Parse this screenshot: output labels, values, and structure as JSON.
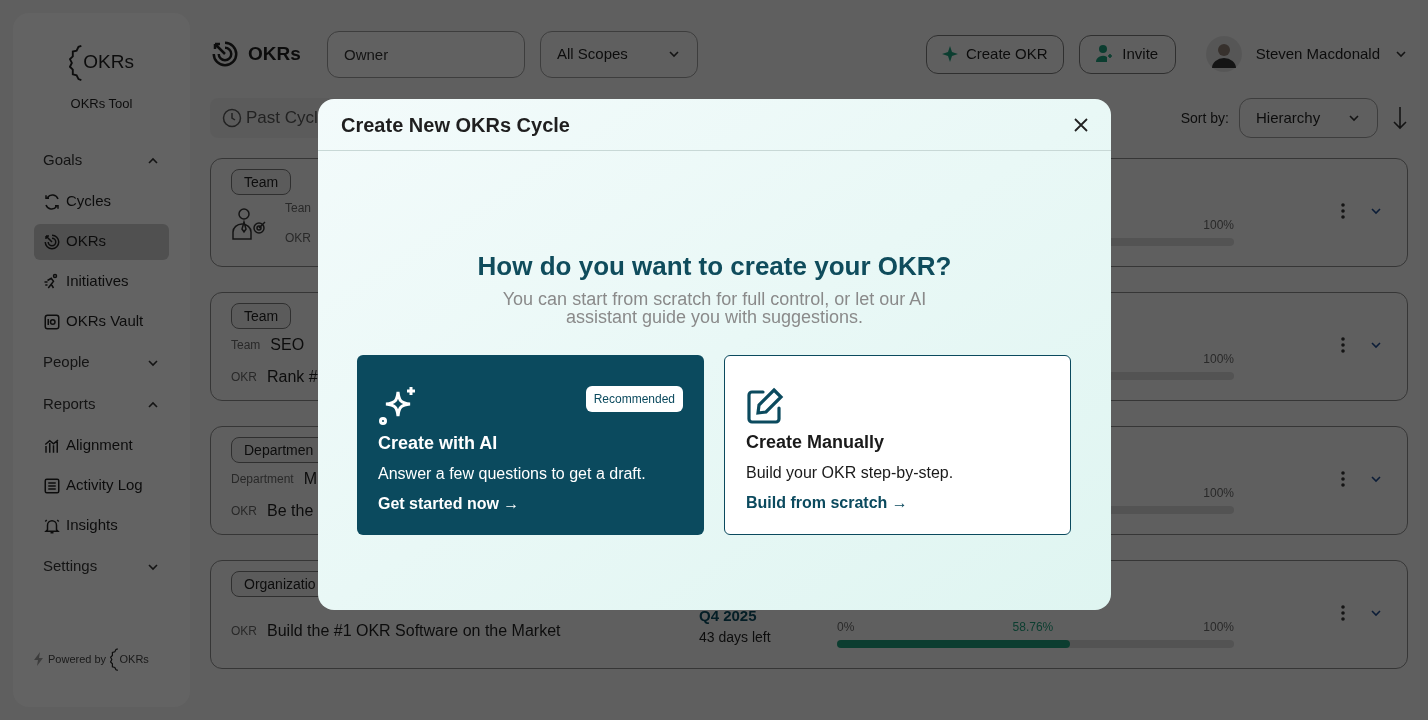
{
  "header": {
    "logo_text": "OKRs",
    "owner_placeholder": "Owner",
    "scope": "All Scopes",
    "create_button": "Create OKR",
    "invite_button": "Invite",
    "user_name": "Steven Macdonald"
  },
  "sidebar": {
    "logo_text": "OKRs",
    "app_name": "OKRs Tool",
    "items": [
      {
        "kind": "section",
        "label": "Goals",
        "expanded": true
      },
      {
        "kind": "link",
        "label": "Cycles",
        "selected": false
      },
      {
        "kind": "link",
        "label": "OKRs",
        "selected": true
      },
      {
        "kind": "link",
        "label": "Initiatives",
        "selected": false
      },
      {
        "kind": "link",
        "label": "OKRs Vault",
        "selected": false
      },
      {
        "kind": "section",
        "label": "People",
        "expanded": false
      },
      {
        "kind": "section",
        "label": "Reports",
        "expanded": true
      },
      {
        "kind": "link",
        "label": "Alignment",
        "selected": false
      },
      {
        "kind": "link",
        "label": "Activity Log",
        "selected": false
      },
      {
        "kind": "link",
        "label": "Insights",
        "selected": false
      },
      {
        "kind": "section",
        "label": "Settings",
        "expanded": false
      }
    ],
    "footer": {
      "label": "Powered by",
      "logo_text": "OKRs"
    }
  },
  "toolbar": {
    "past_cycles": "Past Cycl",
    "sort_label": "Sort by:",
    "sort_value": "Hierarchy"
  },
  "cards": [
    {
      "kind": "icon",
      "tag": "Team",
      "rows": [
        {
          "label": "Tean"
        },
        {
          "label": "OKR"
        }
      ],
      "progress": {
        "max": "100%"
      }
    },
    {
      "kind": "rows",
      "tag": "Team",
      "rows": [
        {
          "label": "Team",
          "value": "SEO"
        },
        {
          "label": "OKR",
          "value": "Rank #"
        }
      ],
      "progress": {
        "max": "100%"
      }
    },
    {
      "kind": "rows",
      "tag": "Departmen",
      "rows": [
        {
          "label": "Department",
          "value": "M"
        },
        {
          "label": "OKR",
          "value": "Be the"
        }
      ],
      "progress": {
        "max": "100%"
      }
    },
    {
      "kind": "rows",
      "tag": "Organizatio",
      "rows": [
        {
          "label": "OKR",
          "value": "Build the #1 OKR Software on the Market"
        }
      ],
      "cycle": "Q4 2025",
      "days_left": "43 days left",
      "progress": {
        "min": "0%",
        "value_label": "58.76%",
        "max": "100%",
        "level": 0.5876
      }
    }
  ],
  "modal": {
    "title": "Create New OKRs Cycle",
    "heading": "How do you want to create your OKR?",
    "subtitle": "You can start from scratch for full control, or let our AI assistant guide you with suggestions.",
    "options": [
      {
        "kind": "ai",
        "title": "Create with AI",
        "badge": "Recommended",
        "description": "Answer a few questions to get a draft.",
        "link": "Get started now →"
      },
      {
        "kind": "manual",
        "title": "Create Manually",
        "description": "Build your OKR step-by-step.",
        "link": "Build from scratch →"
      }
    ]
  }
}
